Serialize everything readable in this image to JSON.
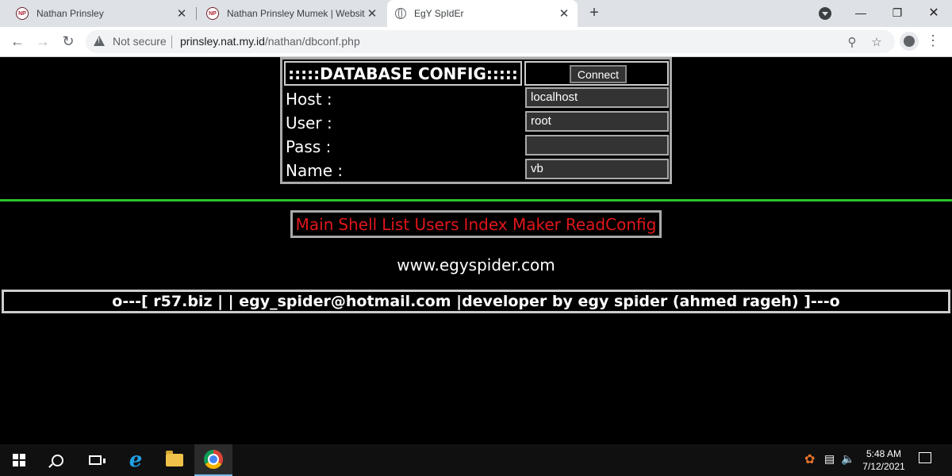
{
  "browser": {
    "tabs": [
      {
        "title": "Nathan Prinsley",
        "favicon": "NP",
        "active": false
      },
      {
        "title": "Nathan Prinsley Mumek | Website",
        "favicon": "NP",
        "active": false
      },
      {
        "title": "EgY SpIdEr",
        "favicon": "globe-icon",
        "active": true
      }
    ],
    "security": "Not secure",
    "url_host": "prinsley.nat.my.id",
    "url_path": "/nathan/dbconf.php"
  },
  "db_config": {
    "heading": ":::::DATABASE CONFIG:::::",
    "connect_label": "Connect",
    "fields": [
      {
        "label": "Host :",
        "value": "localhost"
      },
      {
        "label": "User :",
        "value": "root"
      },
      {
        "label": "Pass :",
        "value": ""
      },
      {
        "label": "Name :",
        "value": "vb"
      }
    ]
  },
  "menu": [
    "Main",
    "Shell",
    "List Users",
    "Index Maker",
    "ReadConfig"
  ],
  "site": "www.egyspider.com",
  "footer": "o---[ r57.biz | | egy_spider@hotmail.com |developer by egy spider (ahmed rageh) ]---o",
  "taskbar": {
    "time": "5:48 AM",
    "date": "7/12/2021"
  },
  "colors": {
    "menu_link": "#e0161a",
    "separator": "#2ec32e",
    "background": "#000000"
  }
}
